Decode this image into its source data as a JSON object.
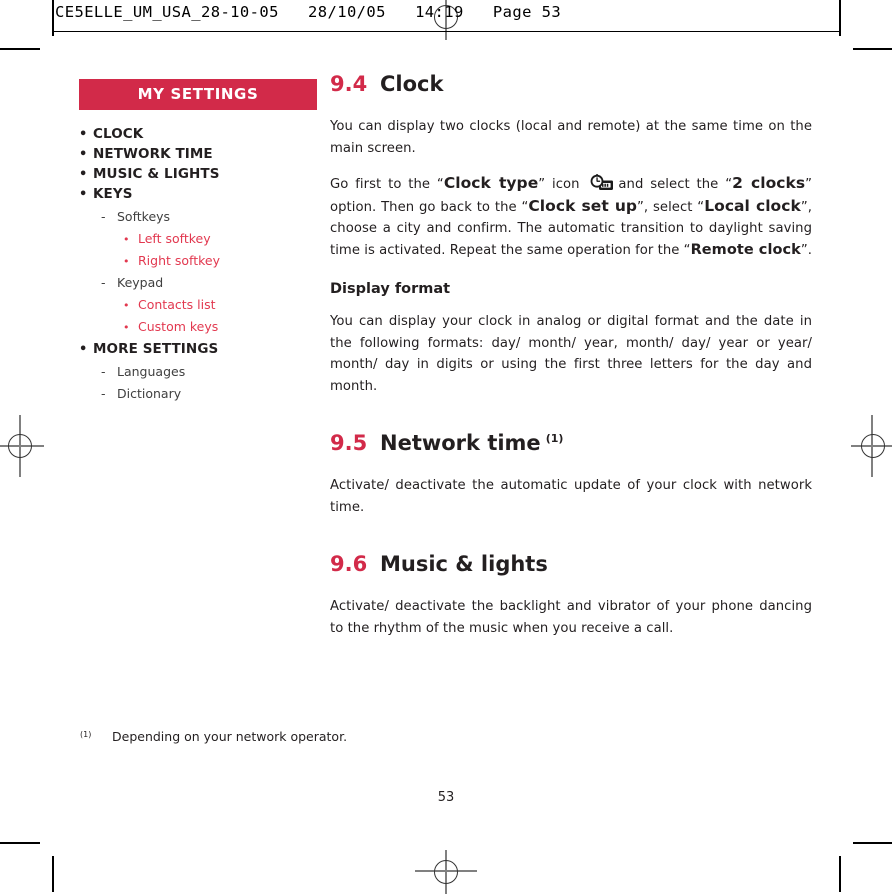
{
  "slug": {
    "text": "CE5ELLE_UM_USA_28-10-05   28/10/05   14:19   Page 53"
  },
  "colors": {
    "brand_red": "#d22a49",
    "link_red": "#e2384f",
    "body_text": "#231f20"
  },
  "sidebar": {
    "title": "MY SETTINGS",
    "items": [
      {
        "level": 1,
        "bullet": "•",
        "label": "CLOCK"
      },
      {
        "level": 1,
        "bullet": "•",
        "label": "NETWORK TIME"
      },
      {
        "level": 1,
        "bullet": "•",
        "label": "MUSIC & LIGHTS"
      },
      {
        "level": 1,
        "bullet": "•",
        "label": "KEYS"
      },
      {
        "level": 2,
        "bullet": "-",
        "label": "Softkeys"
      },
      {
        "level": 3,
        "bullet": "•",
        "label": "Left softkey"
      },
      {
        "level": 3,
        "bullet": "•",
        "label": "Right softkey"
      },
      {
        "level": 2,
        "bullet": "-",
        "label": "Keypad"
      },
      {
        "level": 3,
        "bullet": "•",
        "label": "Contacts list"
      },
      {
        "level": 3,
        "bullet": "•",
        "label": "Custom keys"
      },
      {
        "level": 1,
        "bullet": "•",
        "label": "MORE SETTINGS"
      },
      {
        "level": 2,
        "bullet": "-",
        "label": "Languages"
      },
      {
        "level": 2,
        "bullet": "-",
        "label": "Dictionary"
      }
    ]
  },
  "main": {
    "section_94": {
      "number": "9.4",
      "title": "Clock",
      "para1": "You can display two clocks (local and remote) at the same time on the main screen.",
      "para2": {
        "t1": "Go first to the “",
        "b1": "Clock type",
        "t2": "” icon",
        "icon": "clock-icon",
        "t3": "and select the “",
        "b2": "2 clocks",
        "t4": "” option. Then go back to the “",
        "b3": "Clock set up",
        "t5": "”, select “",
        "b4": "Local clock",
        "t6": "”, choose a city and confirm. The automatic transition to daylight saving time is activated. Repeat the same operation for the “",
        "b5": "Remote clock",
        "t7": "”."
      },
      "subhead": "Display format",
      "para3": "You can display your clock in analog or digital format and the date in the following formats:  day/ month/ year,   month/ day/ year  or year/ month/ day in digits or using the first three letters for the day and month."
    },
    "section_95": {
      "number": "9.5",
      "title": "Network time",
      "sup": "(1)",
      "para1": "Activate/ deactivate the automatic update of your clock with network time."
    },
    "section_96": {
      "number": "9.6",
      "title": "Music & lights",
      "para1": "Activate/ deactivate the backlight and vibrator of your phone dancing to the rhythm of the music when you receive a call."
    }
  },
  "footnote": {
    "mark": "(1)",
    "text": "Depending on your network operator."
  },
  "folio": {
    "page_number": "53"
  }
}
